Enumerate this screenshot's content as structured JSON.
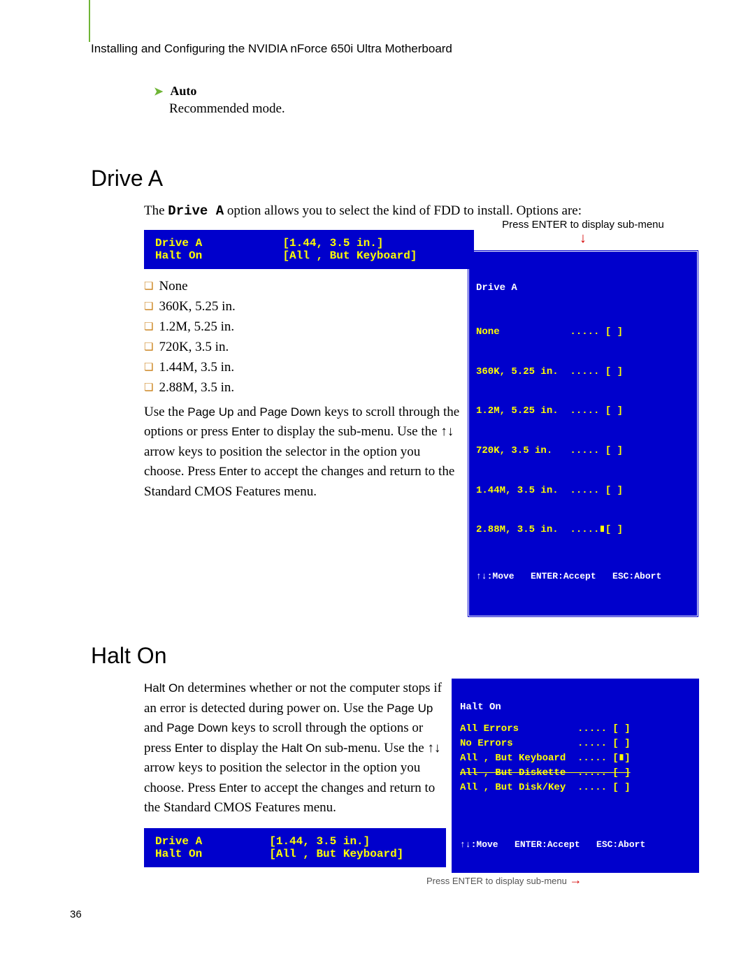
{
  "header": "Installing and Configuring the NVIDIA nForce 650i Ultra Motherboard",
  "auto": {
    "label": "Auto",
    "desc": "Recommended mode."
  },
  "driveA": {
    "heading": "Drive A",
    "intro_pre": "The ",
    "intro_code": "Drive A",
    "intro_post": " option allows you to select the kind of FDD to install. Options are:",
    "submenu_note": "Press ENTER to display sub-menu",
    "bios_line1_lbl": "Drive A",
    "bios_line1_val": "[1.44, 3.5 in.]",
    "bios_line2_lbl": "Halt On",
    "bios_line2_val": "[All , But Keyboard]",
    "options": [
      "None",
      "360K, 5.25 in.",
      "1.2M, 5.25 in.",
      "720K, 3.5 in.",
      "1.44M, 3.5 in.",
      "2.88M, 3.5 in."
    ],
    "menu_title": "Drive A",
    "menu_items": [
      "None            ..... [ ]",
      "360K, 5.25 in.  ..... [ ]",
      "1.2M, 5.25 in.  ..... [ ]",
      "720K, 3.5 in.   ..... [ ]",
      "1.44M, 3.5 in.  ..... [ ]",
      "2.88M, 3.5 in.  .....∎[ ]"
    ],
    "menu_footer": "↑↓:Move   ENTER:Accept   ESC:Abort",
    "para2a": "Use the ",
    "para2b": " and ",
    "para2c": " keys to scroll through the options or press ",
    "para2d": " to display the sub-menu. Use the ↑↓ arrow keys to position the selector in the option you choose. Press ",
    "para2e": " to accept the changes and return to the Standard CMOS Features menu.",
    "pageup": "Page Up",
    "pagedown": "Page Down",
    "enter": "Enter"
  },
  "haltOn": {
    "heading": "Halt On",
    "para_a": " determines whether or not the computer stops if an error is detected during power on. Use the ",
    "para_b": " and ",
    "para_c": " keys to scroll through the options or press ",
    "para_d": " to display the ",
    "para_e": " sub-menu. Use the ↑↓ arrow keys to position the selector in the option you choose. Press ",
    "para_f": " to accept the changes and return to the Standard CMOS Features menu.",
    "halton": "Halt On",
    "pageup": "Page Up",
    "pagedown": "Page Down",
    "enter": "Enter",
    "bios2_line1_lbl": "Drive A",
    "bios2_line1_val": "[1.44, 3.5 in.]",
    "bios2_line2_lbl": "Halt On",
    "bios2_line2_val": "[All , But Keyboard]",
    "submenu_note2": "Press ENTER to display sub-menu",
    "menu_title": "Halt On",
    "menu_items": [
      "All Errors          ..... [ ]",
      "No Errors           ..... [ ]",
      "All , But Keyboard  ..... [∎]",
      "All , But Diskette  ..... [ ]",
      "All , But Disk/Key  ..... [ ]"
    ],
    "menu_footer": "↑↓:Move   ENTER:Accept   ESC:Abort"
  },
  "page_number": "36"
}
